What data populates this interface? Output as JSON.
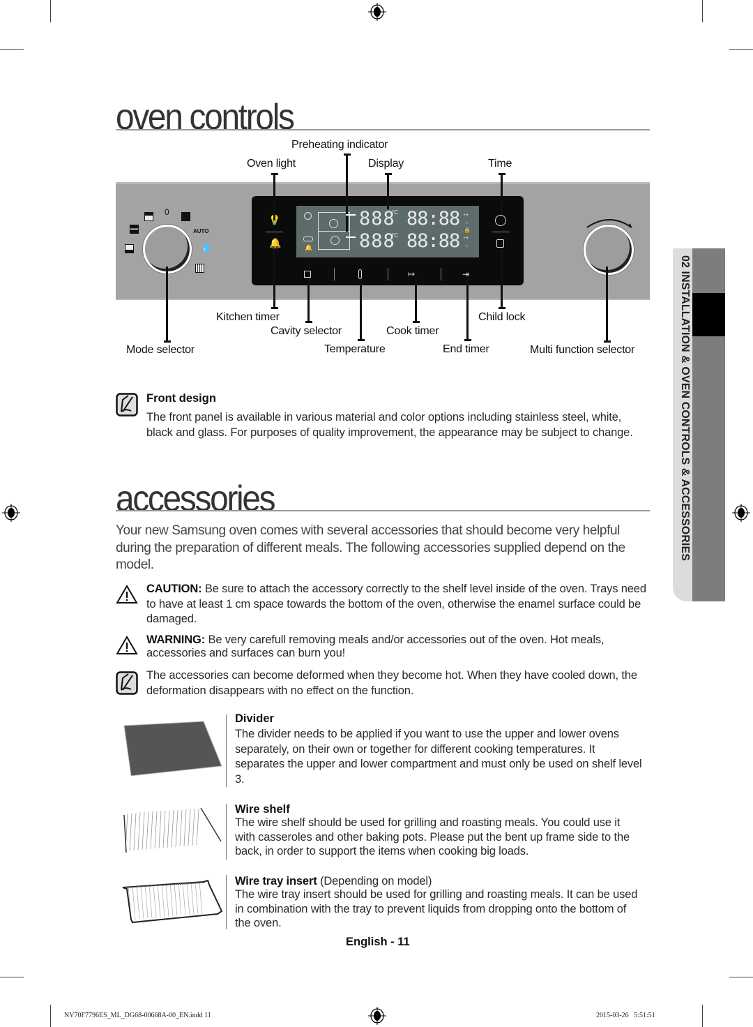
{
  "page": {
    "section_titles": {
      "oven_controls": "oven controls",
      "accessories": "accessories"
    },
    "page_number": "English - 11",
    "side_tab": "02  INSTALLATION & OVEN CONTROLS & ACCESSORIES",
    "footer": {
      "file": "NV70F7796ES_ML_DG68-00668A-00_EN.indd   11",
      "timestamp": "2015-03-26     5:51:51"
    }
  },
  "control_panel": {
    "callouts_top": {
      "preheating_indicator": "Preheating indicator",
      "oven_light": "Oven light",
      "display": "Display",
      "time": "Time"
    },
    "callouts_bottom": {
      "kitchen_timer": "Kitchen timer",
      "cavity_selector": "Cavity selector",
      "cook_timer": "Cook timer",
      "child_lock": "Child lock",
      "mode_selector": "Mode selector",
      "temperature": "Temperature",
      "end_timer": "End timer",
      "multi_function_selector": "Multi function selector"
    },
    "mode_dial": {
      "off_label": "0",
      "auto_label": "AUTO"
    },
    "display": {
      "upper_temp": "888",
      "lower_temp": "888",
      "upper_time": "88:88",
      "lower_time": "88:88",
      "unit": "°C"
    }
  },
  "front_design": {
    "heading": "Front design",
    "body": "The front panel is available in various material and color options including stainless steel, white, black and glass. For purposes of quality improvement, the appearance may be subject to change."
  },
  "accessories": {
    "intro": "Your new Samsung oven comes with several accessories that should become very helpful during the preparation of different meals. The following accessories supplied depend on the model.",
    "caution": {
      "label": "CAUTION:",
      "text": " Be sure to attach the accessory correctly to the shelf level inside of the oven. Trays need to have at least 1 cm space towards the bottom of the oven, otherwise the enamel surface could be damaged."
    },
    "warning": {
      "label": "WARNING:",
      "text": " Be very carefull removing meals and/or accessories out of the oven. Hot meals, accessories and surfaces can burn you!"
    },
    "note": "The accessories can become deformed when they become hot. When they have cooled down, the deformation disappears with no effect on the function.",
    "items": [
      {
        "name": "Divider",
        "suffix": "",
        "description": "The divider needs to be applied if you want to use the upper and lower ovens separately, on their own or together for different cooking temperatures. It separates the upper and lower compartment and must only be used on shelf level 3."
      },
      {
        "name": "Wire shelf",
        "suffix": "",
        "description": "The wire shelf should be used for grilling and roasting meals. You could use it with casseroles and other baking pots. Please put the bent up frame side to the back, in order to support the items when cooking big loads."
      },
      {
        "name": "Wire tray insert",
        "suffix": " (Depending on model)",
        "description": "The wire tray insert should be used for grilling and roasting meals. It can be used in combination with the tray to prevent liquids from dropping onto the bottom of the oven."
      }
    ]
  }
}
